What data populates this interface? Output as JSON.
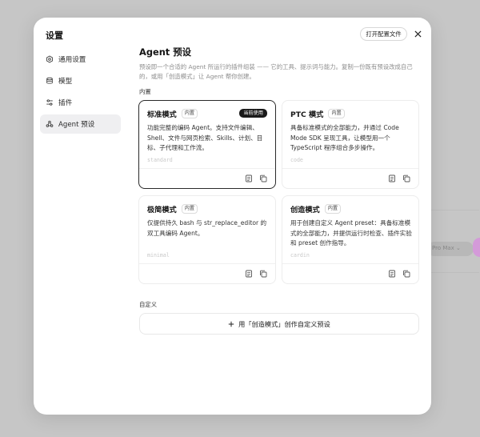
{
  "sidebar": {
    "title": "设置",
    "items": [
      {
        "label": "通用设置",
        "icon": "gear-icon"
      },
      {
        "label": "模型",
        "icon": "model-stack-icon"
      },
      {
        "label": "插件",
        "icon": "sliders-icon"
      },
      {
        "label": "Agent 预设",
        "icon": "agent-preset-icon"
      }
    ],
    "active_index": 3
  },
  "header": {
    "open_config_label": "打开配置文件"
  },
  "main": {
    "title": "Agent 预设",
    "description": "预设即一个合适的 Agent 所运行的插件组装 —— 它的工具、提示词与能力。复制一份既有预设改成自己的，或用「创造模式」让 Agent 帮你创建。",
    "builtin_section_label": "内置",
    "custom_section_label": "自定义",
    "create_button_label": "用「创造模式」创作自定义预设"
  },
  "presets": [
    {
      "name": "标准模式",
      "tag": "内置",
      "current_label": "当前使用",
      "description": "功能完整的编码 Agent。支持文件编辑、Shell、文件与网页检索、Skills、计划、目标、子代理和工作流。",
      "id": "standard",
      "selected": true
    },
    {
      "name": "PTC 模式",
      "tag": "内置",
      "description": "具备标准模式的全部能力，并通过 Code Mode SDK 呈现工具，让模型用一个 TypeScript 程序组合多步操作。",
      "id": "code",
      "selected": false
    },
    {
      "name": "极简模式",
      "tag": "内置",
      "description": "仅提供持久 bash 与 str_replace_editor 的双工具编码 Agent。",
      "id": "minimal",
      "selected": false
    },
    {
      "name": "创造模式",
      "tag": "内置",
      "description": "用于创建自定义 Agent preset：具备标准模式的全部能力，并提供运行时检查、插件实验和 preset 创作指导。",
      "id": "cardin",
      "selected": false
    }
  ],
  "colors": {
    "accent": "#1a1a1a",
    "active_sidebar_bg": "#efeff1",
    "muted_text": "#8c8c8c"
  }
}
